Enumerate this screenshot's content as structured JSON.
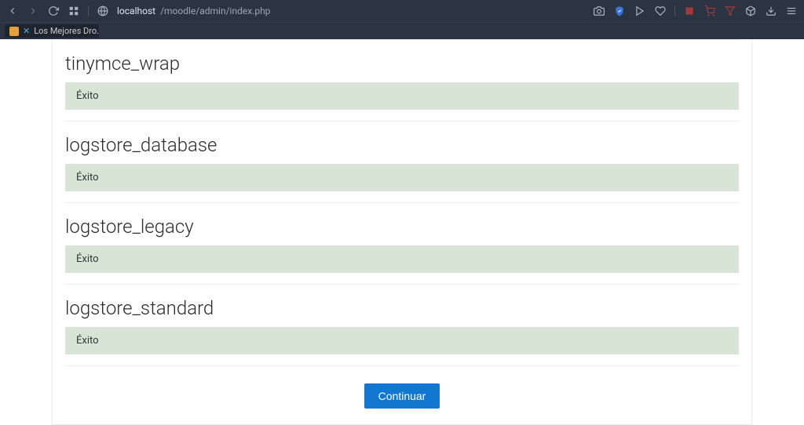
{
  "browser": {
    "url_host": "localhost",
    "url_path": "/moodle/admin/index.php",
    "tab_title": "Los Mejores Dro..."
  },
  "sections": [
    {
      "title": "tinymce_wrap",
      "status": "Éxito"
    },
    {
      "title": "logstore_database",
      "status": "Éxito"
    },
    {
      "title": "logstore_legacy",
      "status": "Éxito"
    },
    {
      "title": "logstore_standard",
      "status": "Éxito"
    }
  ],
  "continue_label": "Continuar"
}
